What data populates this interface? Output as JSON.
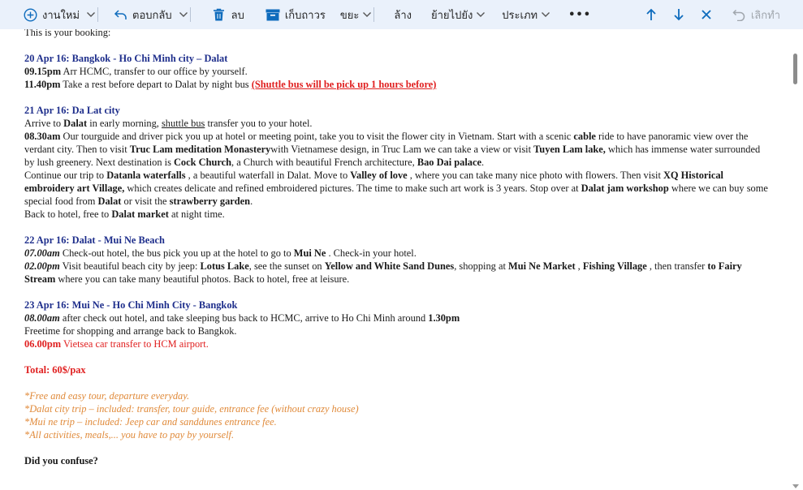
{
  "toolbar": {
    "new_label": "งานใหม่",
    "reply_label": "ตอบกลับ",
    "delete_label": "ลบ",
    "archive_label": "เก็บถาวร",
    "junk_label": "ขยะ",
    "sweep_label": "ล้าง",
    "move_label": "ย้ายไปยัง",
    "categorize_label": "ประเภท",
    "undo_label": "เลิกทำ",
    "more_label": "•••",
    "accent": "#0f6cbd"
  },
  "message": {
    "intro": "This is your booking:",
    "day1": {
      "title": "20 Apr 16: Bangkok - Ho Chi Minh city – Dalat",
      "l1_time": "09.15pm",
      "l1_text": " Arr HCMC, transfer to our office by yourself.",
      "l2_time": "11.40pm",
      "l2_text": "  Take a rest before depart to   Dalat by night bus ",
      "l2_red": "(Shuttle bus will be pick up 1 hours before)"
    },
    "day2": {
      "title": "21 Apr 16: Da Lat city",
      "a1": "Arrive to ",
      "a2": "Dalat",
      "a3": " in early morning, ",
      "a4": " shuttle bus",
      "a5": " transfer you to your hotel.",
      "b_time": "08.30am",
      "b1": " Our tourguide and driver pick you up at hotel or meeting point, take you to visit the flower city in Vietnam. Start with a scenic  ",
      "b2": "cable",
      "b3": "  ride to have panoramic view over the verdant city. Then to visit ",
      "b4": "Truc Lam meditation Monastery",
      "b5": "with Vietnamese design, in Truc Lam we can take a view or visit ",
      "b6": "Tuyen Lam lake,",
      "b7": " which has immense water surrounded by lush greenery. Next destination is   ",
      "b8": "Cock  Church",
      "b9": ", a Church with beautiful French architecture, ",
      "b10": "Bao Dai palace",
      "b11": ".",
      "c1": "Continue our trip to ",
      "c2": "Datanla waterfalls",
      "c3": " , a beautiful waterfall in Dalat. Move to  ",
      "c4": "Valley of love",
      "c5": " , where you can take many nice photo with flowers. Then visit  ",
      "c6": "XQ Historical embroidery art Village,",
      "c7": "   which creates delicate and refined embroidered pictures. The time to make such art work is 3 years. Stop over at ",
      "c8": "Dalat jam workshop",
      "c9": "  where we can buy some special food from ",
      "c10": "Dalat",
      "c11": " or visit the    ",
      "c12": "strawberry garden",
      "c13": ".",
      "d1": "Back to hotel, free to ",
      "d2": "Dalat market",
      "d3": "  at night time."
    },
    "day3": {
      "title": "22 Apr 16: Dalat - Mui Ne Beach",
      "a_time": "07.00am",
      "a1": "   Check-out hotel, the bus pick you up at the hotel to go to ",
      "a2": "Mui Ne",
      "a3": " . Check-in your hotel.",
      "b_time": "02.00pm",
      "b1": "   Visit beautiful beach city by jeep:  ",
      "b2": "Lotus Lake",
      "b3": ", see the sunset on   ",
      "b4": "Yellow and White Sand Dunes",
      "b5": ", shopping at ",
      "b6": "Mui Ne Market",
      "b7": " , ",
      "b8": "Fishing Village",
      "b9": "  , then transfer  ",
      "b10": "to Fairy Stream",
      "b11": "  where you can take many beautiful photos. Back to hotel, free at leisure."
    },
    "day4": {
      "title": "23 Apr 16: Mui Ne - Ho Chi Minh City - Bangkok",
      "a_time": "08.00am",
      "a1": " after check out hotel, and take sleeping bus back to HCMC, arrive to Ho Chi Minh around ",
      "a2": "1.30pm",
      "b": "Freetime for shopping and arrange back to Bangkok.",
      "c_time": "06.00pm",
      "c_text": " Vietsea car transfer to HCM airport."
    },
    "total": "Total: 60$/pax",
    "notes": [
      "*Free and easy tour, departure everyday.",
      "*Dalat city trip – included: transfer, tour guide, entrance fee (without crazy house)",
      "*Mui ne trip – included: Jeep car and sanddunes entrance fee.",
      "*All activities, meals,... you have to pay by yourself."
    ],
    "closing": "Did you confuse?"
  }
}
